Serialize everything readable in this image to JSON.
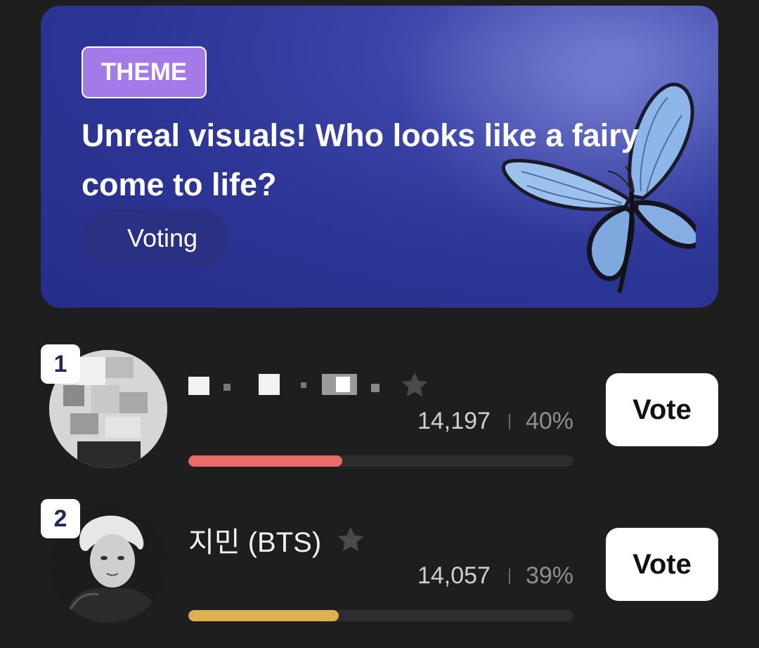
{
  "banner": {
    "badge": "THEME",
    "title": "Unreal visuals! Who looks like a fairy come to life?",
    "status": "Voting",
    "image": "blue-butterfly"
  },
  "candidates": [
    {
      "rank": "1",
      "name": "",
      "name_obscured": true,
      "votes": "14,197",
      "percent": "40%",
      "bar_fraction": 0.4,
      "bar_color": "#e86a6a",
      "vote_label": "Vote",
      "icon": "star-icon"
    },
    {
      "rank": "2",
      "name": "지민 (BTS)",
      "votes": "14,057",
      "percent": "39%",
      "bar_fraction": 0.39,
      "bar_color": "#e0b050",
      "vote_label": "Vote",
      "icon": "star-icon"
    }
  ],
  "colors": {
    "background": "#1e1e1e",
    "banner": "#2c3594",
    "badge": "#a47ae8",
    "star": "#4a4a4a"
  }
}
